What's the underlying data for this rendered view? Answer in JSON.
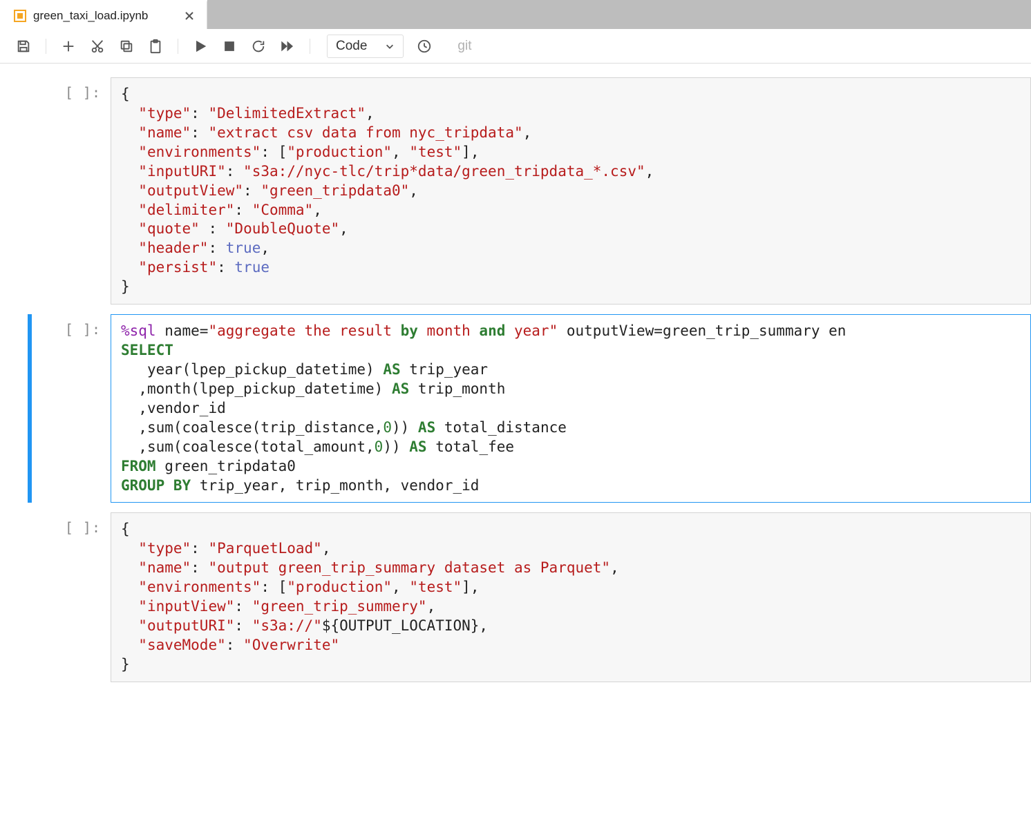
{
  "tab": {
    "filename": "green_taxi_load.ipynb"
  },
  "toolbar": {
    "cell_type": "Code",
    "git_label": "git"
  },
  "cells": [
    {
      "prompt": "[ ]:",
      "active": false,
      "code_html": "<span class='k-brace'>{</span>\n  <span class='k-key'>\"type\"</span><span class='k-punct'>:</span> <span class='k-str'>\"DelimitedExtract\"</span><span class='k-punct'>,</span>\n  <span class='k-key'>\"name\"</span><span class='k-punct'>:</span> <span class='k-str'>\"extract csv data from nyc_tripdata\"</span><span class='k-punct'>,</span>\n  <span class='k-key'>\"environments\"</span><span class='k-punct'>:</span> <span class='k-punct'>[</span><span class='k-str'>\"production\"</span><span class='k-punct'>,</span> <span class='k-str'>\"test\"</span><span class='k-punct'>],</span>\n  <span class='k-key'>\"inputURI\"</span><span class='k-punct'>:</span> <span class='k-str'>\"s3a://nyc-tlc/trip*data/green_tripdata_*.csv\"</span><span class='k-punct'>,</span>\n  <span class='k-key'>\"outputView\"</span><span class='k-punct'>:</span> <span class='k-str'>\"green_tripdata0\"</span><span class='k-punct'>,</span>\n  <span class='k-key'>\"delimiter\"</span><span class='k-punct'>:</span> <span class='k-str'>\"Comma\"</span><span class='k-punct'>,</span>\n  <span class='k-key'>\"quote\"</span> <span class='k-punct'>:</span> <span class='k-str'>\"DoubleQuote\"</span><span class='k-punct'>,</span>\n  <span class='k-key'>\"header\"</span><span class='k-punct'>:</span> <span class='k-bool'>true</span><span class='k-punct'>,</span>\n  <span class='k-key'>\"persist\"</span><span class='k-punct'>:</span> <span class='k-bool'>true</span>\n<span class='k-brace'>}</span>"
    },
    {
      "prompt": "[ ]:",
      "active": true,
      "code_html": "<span class='k-magic'>%sql</span> <span class='k-ident'>name=</span><span class='k-str'>\"aggregate the result </span><span class='k-kw2'>by</span><span class='k-str'> month </span><span class='k-kw2'>and</span><span class='k-str'> year\"</span> <span class='k-ident'>outputView=green_trip_summary en</span>\n<span class='k-kw'>SELECT</span>\n   <span class='k-ident'>year(lpep_pickup_datetime)</span> <span class='k-kw'>AS</span> <span class='k-ident'>trip_year</span>\n  <span class='k-ident'>,month(lpep_pickup_datetime)</span> <span class='k-kw'>AS</span> <span class='k-ident'>trip_month</span>\n  <span class='k-ident'>,vendor_id</span>\n  <span class='k-ident'>,sum(coalesce(trip_distance,</span><span class='k-num'>0</span><span class='k-ident'>))</span> <span class='k-kw'>AS</span> <span class='k-ident'>total_distance</span>\n  <span class='k-ident'>,sum(coalesce(total_amount,</span><span class='k-num'>0</span><span class='k-ident'>))</span> <span class='k-kw'>AS</span> <span class='k-ident'>total_fee</span>\n<span class='k-kw'>FROM</span> <span class='k-ident'>green_tripdata0</span>\n<span class='k-kw'>GROUP BY</span> <span class='k-ident'>trip_year, trip_month, vendor_id</span>"
    },
    {
      "prompt": "[ ]:",
      "active": false,
      "code_html": "<span class='k-brace'>{</span>\n  <span class='k-key'>\"type\"</span><span class='k-punct'>:</span> <span class='k-str'>\"ParquetLoad\"</span><span class='k-punct'>,</span>\n  <span class='k-key'>\"name\"</span><span class='k-punct'>:</span> <span class='k-str'>\"output green_trip_summary dataset as Parquet\"</span><span class='k-punct'>,</span>\n  <span class='k-key'>\"environments\"</span><span class='k-punct'>:</span> <span class='k-punct'>[</span><span class='k-str'>\"production\"</span><span class='k-punct'>,</span> <span class='k-str'>\"test\"</span><span class='k-punct'>],</span>\n  <span class='k-key'>\"inputView\"</span><span class='k-punct'>:</span> <span class='k-str'>\"green_trip_summery\"</span><span class='k-punct'>,</span>\n  <span class='k-key'>\"outputURI\"</span><span class='k-punct'>:</span> <span class='k-str'>\"s3a://\"</span><span class='k-ident'>${OUTPUT_LOCATION},</span>\n  <span class='k-key'>\"saveMode\"</span><span class='k-punct'>:</span> <span class='k-str'>\"Overwrite\"</span>\n<span class='k-brace'>}</span>"
    }
  ]
}
